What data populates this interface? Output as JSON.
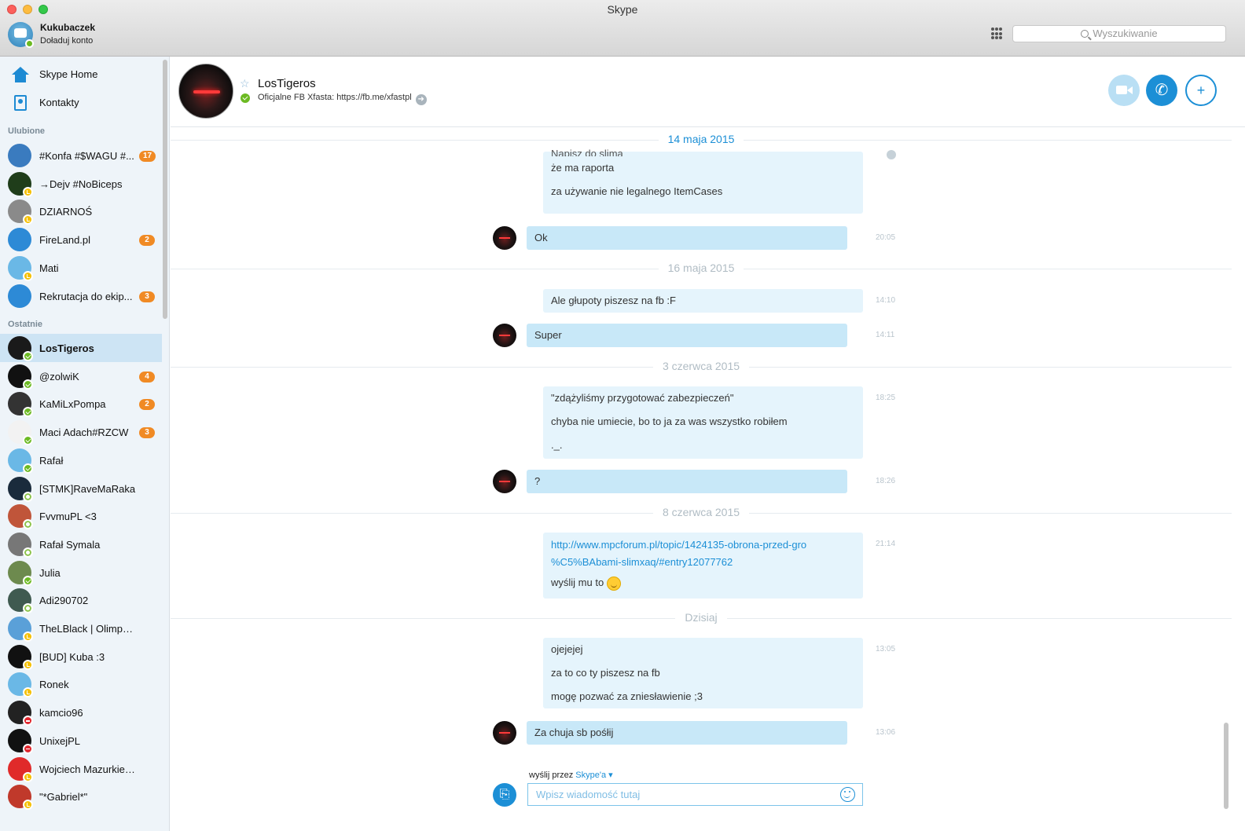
{
  "window": {
    "title": "Skype"
  },
  "me": {
    "name": "Kukubaczek",
    "subtitle": "Doładuj konto"
  },
  "search": {
    "placeholder": "Wyszukiwanie"
  },
  "nav": {
    "home_label": "Skype Home",
    "contacts_label": "Kontakty"
  },
  "favorites_label": "Ulubione",
  "recent_label": "Ostatnie",
  "favorites": [
    {
      "name": "#Konfa #$WAGU #...",
      "badge": "17",
      "status": "none"
    },
    {
      "name": "→Dejv #NoBiceps",
      "badge": "",
      "status": "away"
    },
    {
      "name": "DZIARNOŚ",
      "badge": "",
      "status": "away"
    },
    {
      "name": "FireLand.pl",
      "badge": "2",
      "status": "none"
    },
    {
      "name": "Mati",
      "badge": "",
      "status": "away"
    },
    {
      "name": "Rekrutacja do ekip...",
      "badge": "3",
      "status": "none"
    }
  ],
  "recent": [
    {
      "name": "LosTigeros",
      "badge": "",
      "status": "online",
      "active": true
    },
    {
      "name": "@zolwiK",
      "badge": "4",
      "status": "online"
    },
    {
      "name": "KaMiLxPompa",
      "badge": "2",
      "status": "online"
    },
    {
      "name": "Maci Adach#RZCW",
      "badge": "3",
      "status": "online"
    },
    {
      "name": "Rafał",
      "badge": "",
      "status": "online"
    },
    {
      "name": "[STMK]RaveMaRaka",
      "badge": "",
      "status": "offline"
    },
    {
      "name": "FvvmuPL <3",
      "badge": "",
      "status": "offline"
    },
    {
      "name": "Rafał Symala",
      "badge": "",
      "status": "offline"
    },
    {
      "name": "Julia",
      "badge": "",
      "status": "online"
    },
    {
      "name": "Adi290702",
      "badge": "",
      "status": "offline"
    },
    {
      "name": "TheLBlack | OlimpMc.pl",
      "badge": "",
      "status": "away"
    },
    {
      "name": "[BUD] Kuba :3",
      "badge": "",
      "status": "away"
    },
    {
      "name": "Ronek",
      "badge": "",
      "status": "away"
    },
    {
      "name": "kamcio96",
      "badge": "",
      "status": "dnd"
    },
    {
      "name": "UnixejPL",
      "badge": "",
      "status": "dnd"
    },
    {
      "name": "Wojciech Mazurkiewicz",
      "badge": "",
      "status": "away"
    },
    {
      "name": "\"*Gabriel*\"",
      "badge": "",
      "status": "away"
    }
  ],
  "header": {
    "name": "LosTigeros",
    "mood": "Oficjalne FB Xfasta: https://fb.me/xfastpl"
  },
  "dates": [
    "14 maja 2015",
    "16 maja 2015",
    "3 czerwca 2015",
    "8 czerwca 2015",
    "Dzisiaj"
  ],
  "messages": [
    {
      "from": "me",
      "lines": [
        "Napisz do slima",
        "że ma raporta",
        "za używanie nie legalnego ItemCases"
      ],
      "time": ""
    },
    {
      "from": "them",
      "lines": [
        "Ok"
      ],
      "time": "20:05"
    },
    {
      "from": "me",
      "lines": [
        "Ale głupoty piszesz na fb :F"
      ],
      "time": "14:10"
    },
    {
      "from": "them",
      "lines": [
        "Super"
      ],
      "time": "14:11"
    },
    {
      "from": "me",
      "lines": [
        "\"zdążyliśmy przygotować zabezpieczeń\"",
        "chyba nie umiecie, bo to ja za was wszystko robiłem",
        "._."
      ],
      "time": "18:25"
    },
    {
      "from": "them",
      "lines": [
        "?"
      ],
      "time": "18:26"
    },
    {
      "from": "me",
      "link_line1": "http://www.mpcforum.pl/topic/1424135-obrona-przed-gro",
      "link_line2": "%C5%BAbami-slimxaq/#entry12077762",
      "after": "wyślij mu to",
      "time": "21:14"
    },
    {
      "from": "me",
      "lines": [
        "ojejejej",
        "za to co ty piszesz na fb",
        "mogę pozwać za zniesławienie ;3"
      ],
      "time": "13:05"
    },
    {
      "from": "them",
      "lines": [
        "Za chuja sb pośłij"
      ],
      "time": "13:06"
    }
  ],
  "composer": {
    "send_via_prefix": "wyślij przez",
    "send_via_service": "Skype'a ▾",
    "placeholder": "Wpisz wiadomość tutaj"
  }
}
